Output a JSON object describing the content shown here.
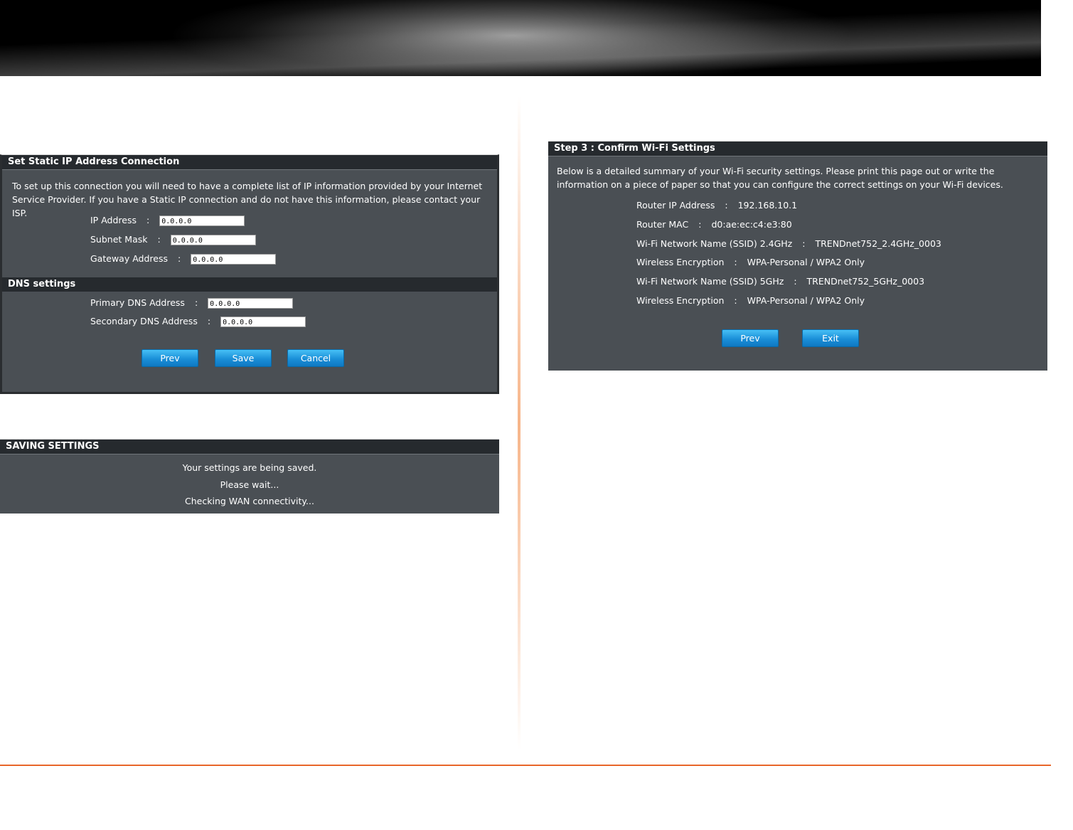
{
  "static_ip": {
    "title": "Set Static IP Address Connection",
    "description": "To set up this connection you will need to have a complete list of IP information provided by your Internet Service Provider. If you have a Static IP connection and do not have this information, please contact your ISP.",
    "ip_label": "IP Address",
    "ip_value": "0.0.0.0",
    "subnet_label": "Subnet Mask",
    "subnet_value": "0.0.0.0",
    "gateway_label": "Gateway Address",
    "gateway_value": "0.0.0.0",
    "dns_title": "DNS settings",
    "primary_dns_label": "Primary DNS Address",
    "primary_dns_value": "0.0.0.0",
    "secondary_dns_label": "Secondary DNS Address",
    "secondary_dns_value": "0.0.0.0",
    "prev_label": "Prev",
    "save_label": "Save",
    "cancel_label": "Cancel",
    "colon": ":"
  },
  "saving": {
    "title": "SAVING SETTINGS",
    "line1": "Your settings are being saved.",
    "line2": "Please wait...",
    "line3": "Checking WAN connectivity..."
  },
  "confirm": {
    "title": "Step 3 : Confirm Wi-Fi Settings",
    "description": "Below is a detailed summary of your Wi-Fi security settings. Please print this page out or write the information on a piece of paper so that you can configure the correct settings on your Wi-Fi devices.",
    "rows": [
      {
        "label": "Router IP Address",
        "value": "192.168.10.1"
      },
      {
        "label": "Router MAC",
        "value": "d0:ae:ec:c4:e3:80"
      },
      {
        "label": "Wi-Fi Network Name (SSID) 2.4GHz",
        "value": "TRENDnet752_2.4GHz_0003"
      },
      {
        "label": "Wireless Encryption",
        "value": "WPA-Personal / WPA2 Only"
      },
      {
        "label": "Wi-Fi Network Name (SSID) 5GHz",
        "value": "TRENDnet752_5GHz_0003"
      },
      {
        "label": "Wireless Encryption",
        "value": "WPA-Personal / WPA2 Only"
      }
    ],
    "prev_label": "Prev",
    "exit_label": "Exit"
  },
  "colors": {
    "panel_bg": "#4a4f54",
    "header_bg": "#262a2e",
    "button": "#1a8fd8",
    "accent_line": "#e8662a"
  }
}
